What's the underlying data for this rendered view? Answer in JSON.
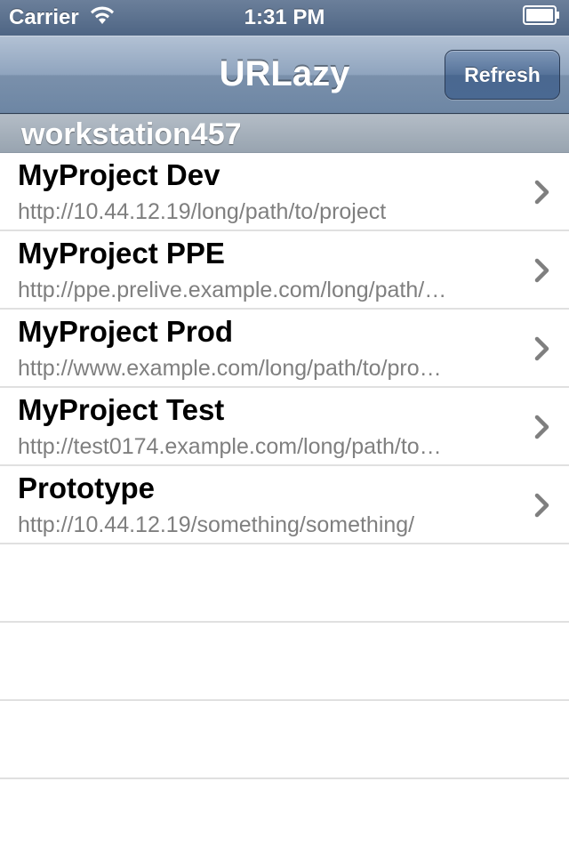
{
  "status_bar": {
    "carrier": "Carrier",
    "time": "1:31 PM",
    "wifi_icon": "wifi-icon",
    "battery_icon": "battery-icon"
  },
  "nav": {
    "title": "URLazy",
    "refresh_label": "Refresh"
  },
  "section": {
    "header": "workstation457"
  },
  "rows": [
    {
      "title": "MyProject Dev",
      "url": "http://10.44.12.19/long/path/to/project"
    },
    {
      "title": "MyProject PPE",
      "url": "http://ppe.prelive.example.com/long/path/…"
    },
    {
      "title": "MyProject Prod",
      "url": "http://www.example.com/long/path/to/pro…"
    },
    {
      "title": "MyProject Test",
      "url": "http://test0174.example.com/long/path/to…"
    },
    {
      "title": "Prototype",
      "url": "http://10.44.12.19/something/something/"
    }
  ],
  "colors": {
    "nav_bar": "#7a90ab",
    "section_header": "#a8b3be",
    "url_text": "#7f7f7f",
    "chevron": "#7f7f7f"
  }
}
